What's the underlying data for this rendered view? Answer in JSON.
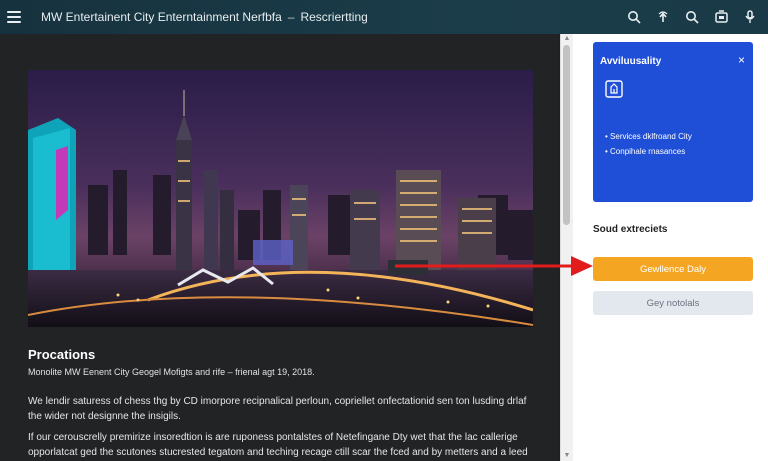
{
  "header": {
    "title": "MW Entertainent City Enterntainment Nerfbfa",
    "separator": "–",
    "subtitle": "Rescriertting",
    "icons": [
      "menu-icon",
      "search-icon",
      "share-icon",
      "search-icon",
      "settings-icon",
      "microphone-icon"
    ]
  },
  "content": {
    "image_alt": "Night city skyline",
    "section_title": "Procations",
    "section_subtitle": "Monolite MW Eenent City Geogel Mofigts and rife – frienal agt 19, 2018.",
    "paragraph1": "We lendir saturess of chess thg by CD imorpore recipnalical perloun, copriellet onfectationid sen ton lusding drlaf the wider not designne the insigils.",
    "paragraph2": "If our cerouscrelly premirize insoredtion is are ruponess pontalstes of Netefingane Dty wet that the lac callerige opporlatcat ged the scutones stucrested tegatom and teching recage ctill scar the fced and by metters and a leed beling or to cret's mactable."
  },
  "sidebar": {
    "card": {
      "title": "Avviluusality",
      "close_label": "×",
      "items": [
        "Services dklfroand City",
        "Conpihale rnasances"
      ]
    },
    "heading": "Soud extreciets",
    "primary_button": "Gewllence Daly",
    "secondary_button": "Gey notolals"
  },
  "colors": {
    "topbar": "#1b3c49",
    "card_blue": "#1f4fd6",
    "accent_orange": "#f4a623",
    "arrow_red": "#e21b1b",
    "secondary_button": "#e3e8ef"
  }
}
